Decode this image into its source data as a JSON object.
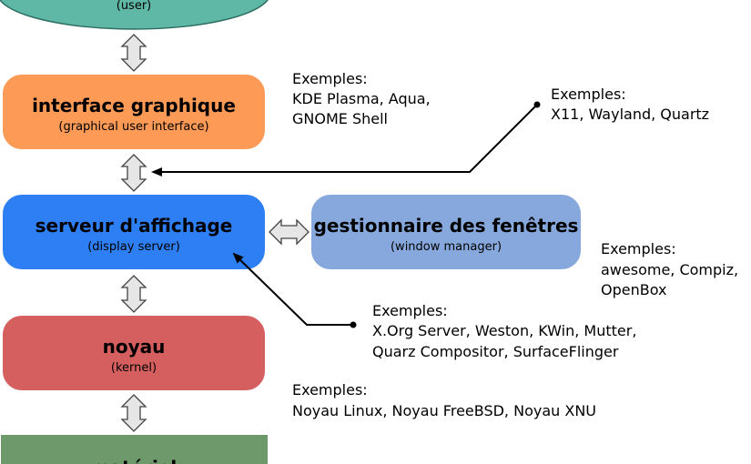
{
  "colors": {
    "user": "#5fb8a6",
    "gui": "#fd9a56",
    "display_server": "#2e7ef4",
    "window_manager": "#86a8dc",
    "kernel": "#d55e5e",
    "hardware": "#6e9a6b",
    "arrow_fill": "#e6e6e6"
  },
  "icons": {
    "double_arrow": "double-arrow-icon"
  },
  "boxes": {
    "user": {
      "subtitle": "(user)"
    },
    "gui": {
      "title": "interface graphique",
      "subtitle": "(graphical user interface)"
    },
    "display_server": {
      "title": "serveur d'affichage",
      "subtitle": "(display server)"
    },
    "window_manager": {
      "title": "gestionnaire des fenêtres",
      "subtitle": "(window manager)"
    },
    "kernel": {
      "title": "noyau",
      "subtitle": "(kernel)"
    },
    "hardware": {
      "title": "matériel"
    }
  },
  "examples": {
    "gui": {
      "heading": "Exemples:",
      "line1": "KDE Plasma, Aqua,",
      "line2": "GNOME Shell"
    },
    "protocols": {
      "heading": "Exemples:",
      "line1": "X11, Wayland, Quartz"
    },
    "window_manager": {
      "heading": "Exemples:",
      "line1": "awesome, Compiz,",
      "line2": "OpenBox"
    },
    "display_server": {
      "heading": "Exemples:",
      "line1": "X.Org Server, Weston, KWin, Mutter,",
      "line2": "Quarz Compositor, SurfaceFlinger"
    },
    "kernel": {
      "heading": "Exemples:",
      "line1": "Noyau Linux, Noyau FreeBSD, Noyau XNU"
    }
  }
}
